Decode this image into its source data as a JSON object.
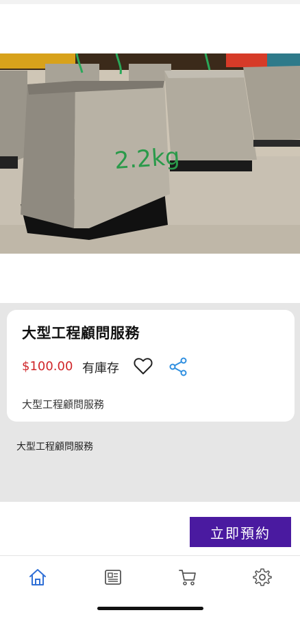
{
  "product": {
    "title": "大型工程顧問服務",
    "price": "$100.00",
    "stock_status": "有庫存",
    "card_description": "大型工程顧問服務",
    "description": "大型工程顧問服務",
    "image_label": "2.2kg"
  },
  "actions": {
    "book_label": "立即預約"
  },
  "nav": {
    "items": [
      {
        "icon": "home-icon",
        "active": true
      },
      {
        "icon": "news-icon",
        "active": false
      },
      {
        "icon": "cart-icon",
        "active": false
      },
      {
        "icon": "settings-icon",
        "active": false
      }
    ]
  },
  "colors": {
    "accent": "#4a1aa0",
    "price": "#d0262a",
    "active_nav": "#2f6fd6",
    "share": "#2f8fe0"
  }
}
